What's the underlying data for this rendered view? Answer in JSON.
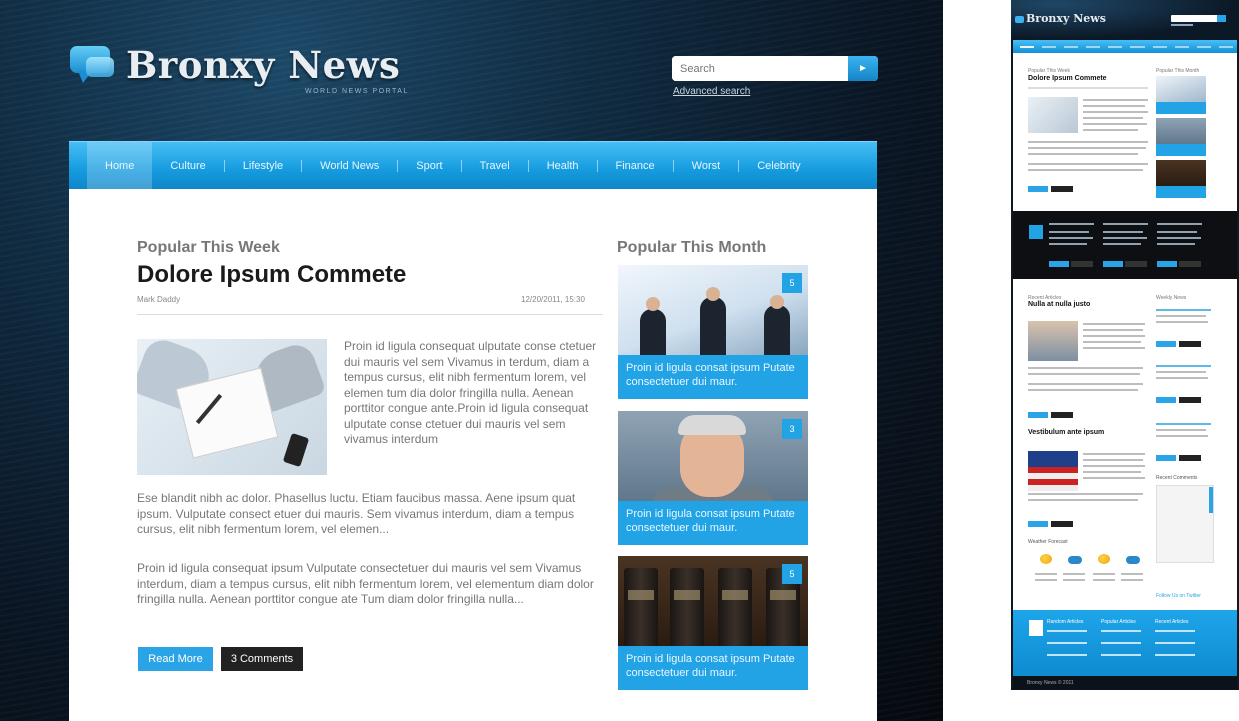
{
  "site": {
    "logo_text": "Bronxy News",
    "tagline": "WORLD NEWS PORTAL"
  },
  "search": {
    "placeholder": "Search",
    "advanced_label": "Advanced search"
  },
  "nav": {
    "items": [
      {
        "label": "Home",
        "active": true
      },
      {
        "label": "Culture"
      },
      {
        "label": "Lifestyle"
      },
      {
        "label": "World News"
      },
      {
        "label": "Sport"
      },
      {
        "label": "Travel"
      },
      {
        "label": "Health"
      },
      {
        "label": "Finance"
      },
      {
        "label": "Worst"
      },
      {
        "label": "Celebrity"
      }
    ]
  },
  "main": {
    "section_title": "Popular This Week",
    "article": {
      "title": "Dolore Ipsum Commete",
      "author": "Mark Daddy",
      "date": "12/20/2011, 15:30",
      "para1": "Proin id ligula consequat ulputate conse ctetuer dui mauris vel sem Vivamus in terdum, diam a tempus cursus, elit nibh fermentum lorem, vel elemen tum dia dolor fringilla nulla. Aenean porttitor congue ante.Proin id ligula consequat ulputate conse ctetuer dui mauris vel sem vivamus interdum",
      "para2": "Ese blandit nibh ac dolor. Phasellus luctu. Etiam faucibus massa. Aene ipsum quat ipsum. Vulputate consect etuer dui mauris. Sem vivamus interdum, diam a tempus cursus, elit nibh fermentum lorem, vel elemen...",
      "para3": "Proin id ligula consequat ipsum Vulputate consectetuer dui mauris vel sem Vivamus interdum, diam a tempus cursus, elit nibh fermentum lorem, vel elementum diam dolor fringilla nulla. Aenean porttitor congue ate Tum diam dolor fringilla nulla...",
      "read_more": "Read More",
      "comments": "3 Comments"
    }
  },
  "sidebar": {
    "title": "Popular This Month",
    "items": [
      {
        "caption": "Proin id ligula consat ipsum Putate consectetuer dui maur.",
        "badge": "5"
      },
      {
        "caption": "Proin id ligula consat ipsum Putate consectetuer dui maur.",
        "badge": "3"
      },
      {
        "caption": "Proin id ligula consat ipsum Putate consectetuer dui maur.",
        "badge": "5"
      }
    ]
  },
  "preview": {
    "logo_text": "Bronxy News",
    "popular_week": "Popular This Week",
    "headline1": "Dolore Ipsum Commete",
    "popular_month": "Popular This Month",
    "recent_articles": "Recent Articles",
    "headline2": "Nulla at nulla justo",
    "weekly_news": "Weekly News",
    "headline3": "Vestibulum ante ipsum",
    "recent_comments": "Recent Comments",
    "weather_title": "Weather Forecast",
    "random_articles": "Random Articles",
    "popular_articles": "Popular Articles",
    "recent_articles_footer": "Recent Articles",
    "follow": "Follow Us on Twitter",
    "copyright": "Bronxy News © 2011"
  },
  "colors": {
    "accent": "#22a3e6",
    "dark": "#0d0f12",
    "text_gray": "#777777"
  }
}
